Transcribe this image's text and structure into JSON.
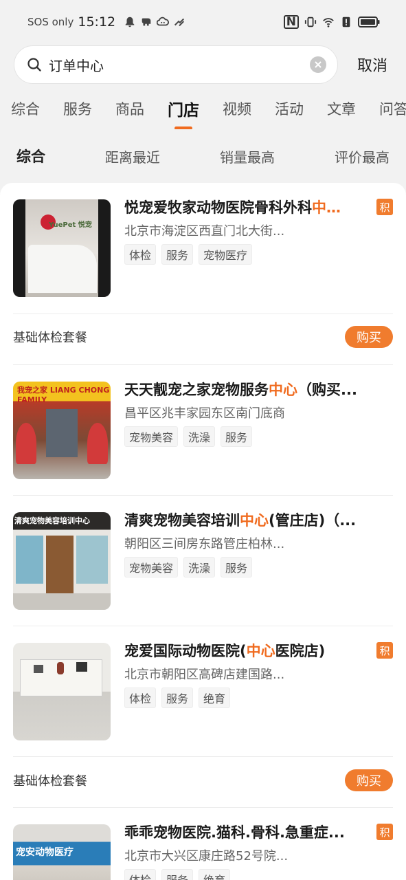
{
  "status": {
    "sos": "SOS only",
    "time": "15:12",
    "nfc": "N"
  },
  "search": {
    "query": "订单中心",
    "cancel": "取消"
  },
  "tabs": [
    "综合",
    "服务",
    "商品",
    "门店",
    "视频",
    "活动",
    "文章",
    "问答"
  ],
  "sort": [
    "综合",
    "距离最近",
    "销量最高",
    "评价最高"
  ],
  "badge_text": "积",
  "stores": [
    {
      "pre": "悦宠爱牧家动物医院骨科外科",
      "hl": "中…",
      "post": "",
      "points": true,
      "address": "北京市海淀区西直门北大街...",
      "tags": [
        "体检",
        "服务",
        "宠物医疗"
      ],
      "package": "基础体检套餐",
      "buy": "购买"
    },
    {
      "pre": "天天靓宠之家宠物服务",
      "hl": "中心",
      "post": "（购买...",
      "points": false,
      "address": "昌平区兆丰家园东区南门底商",
      "tags": [
        "宠物美容",
        "洗澡",
        "服务"
      ]
    },
    {
      "pre": "清爽宠物美容培训",
      "hl": "中心",
      "post": "(管庄店)（...",
      "points": false,
      "address": "朝阳区三间房东路管庄柏林...",
      "tags": [
        "宠物美容",
        "洗澡",
        "服务"
      ]
    },
    {
      "pre": "宠爱国际动物医院(",
      "hl": "中心",
      "post": "医院店)",
      "points": true,
      "address": "北京市朝阳区高碑店建国路...",
      "tags": [
        "体检",
        "服务",
        "绝育"
      ],
      "package": "基础体检套餐",
      "buy": "购买"
    },
    {
      "pre": "乖乖宠物医院.猫科.骨科.急重症...",
      "hl": "",
      "post": "",
      "points": true,
      "address": "北京市大兴区康庄路52号院...",
      "tags": [
        "体检",
        "服务",
        "绝育"
      ]
    }
  ],
  "thumb_signs": [
    "YuePet 悦宠",
    "我宠之家 LIANG CHONG FAMILY",
    "清爽宠物美容培训中心",
    "",
    "宠安动物医疗"
  ],
  "colors": {
    "accent": "#f06b1f",
    "buy_bg": "#f07c2e"
  }
}
